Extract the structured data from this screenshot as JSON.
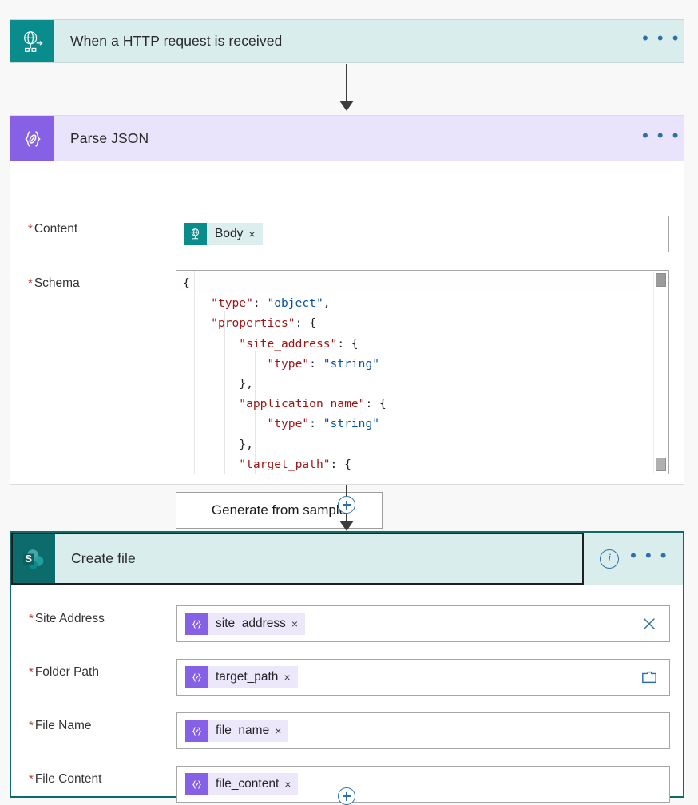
{
  "flow": {
    "trigger": {
      "title": "When a HTTP request is received",
      "icon": "globe-http-icon",
      "menu": "• • •",
      "header_bg": "#d9eded",
      "icon_bg": "#0b8c8c"
    },
    "parse_json": {
      "title": "Parse JSON",
      "icon": "braces-json-icon",
      "menu": "• • •",
      "header_bg": "#e9e4fc",
      "icon_bg": "#8661e5",
      "fields": {
        "content": {
          "label": "Content",
          "required_marker": "*",
          "token": {
            "label": "Body",
            "icon": "globe-http-icon",
            "remove": "×",
            "icon_bg": "#0b8c8c",
            "chip_bg": "#ddeeee"
          }
        },
        "schema": {
          "label": "Schema",
          "required_marker": "*",
          "code_lines": [
            [
              {
                "t": "{",
                "c": "p"
              }
            ],
            [
              {
                "t": "    ",
                "c": "p"
              },
              {
                "t": "\"type\"",
                "c": "k"
              },
              {
                "t": ": ",
                "c": "p"
              },
              {
                "t": "\"object\"",
                "c": "s"
              },
              {
                "t": ",",
                "c": "p"
              }
            ],
            [
              {
                "t": "    ",
                "c": "p"
              },
              {
                "t": "\"properties\"",
                "c": "k"
              },
              {
                "t": ": {",
                "c": "p"
              }
            ],
            [
              {
                "t": "        ",
                "c": "p"
              },
              {
                "t": "\"site_address\"",
                "c": "k"
              },
              {
                "t": ": {",
                "c": "p"
              }
            ],
            [
              {
                "t": "            ",
                "c": "p"
              },
              {
                "t": "\"type\"",
                "c": "k"
              },
              {
                "t": ": ",
                "c": "p"
              },
              {
                "t": "\"string\"",
                "c": "s"
              }
            ],
            [
              {
                "t": "        },",
                "c": "p"
              }
            ],
            [
              {
                "t": "        ",
                "c": "p"
              },
              {
                "t": "\"application_name\"",
                "c": "k"
              },
              {
                "t": ": {",
                "c": "p"
              }
            ],
            [
              {
                "t": "            ",
                "c": "p"
              },
              {
                "t": "\"type\"",
                "c": "k"
              },
              {
                "t": ": ",
                "c": "p"
              },
              {
                "t": "\"string\"",
                "c": "s"
              }
            ],
            [
              {
                "t": "        },",
                "c": "p"
              }
            ],
            [
              {
                "t": "        ",
                "c": "p"
              },
              {
                "t": "\"target_path\"",
                "c": "k"
              },
              {
                "t": ": {",
                "c": "p"
              }
            ]
          ]
        }
      },
      "generate_button": "Generate from sample"
    },
    "create_file": {
      "title": "Create file",
      "icon": "sharepoint-icon",
      "menu": "• • •",
      "info_icon": "info-icon",
      "info_glyph": "i",
      "header_bg": "#d9eded",
      "icon_bg": "#0c6b6b",
      "border_color": "#0c6b6b",
      "fields": [
        {
          "label": "Site Address",
          "required_marker": "*",
          "token": {
            "label": "site_address",
            "icon": "braces-json-icon",
            "remove": "×"
          },
          "trailing_icon": "clear-x-icon"
        },
        {
          "label": "Folder Path",
          "required_marker": "*",
          "token": {
            "label": "target_path",
            "icon": "braces-json-icon",
            "remove": "×"
          },
          "trailing_icon": "folder-picker-icon"
        },
        {
          "label": "File Name",
          "required_marker": "*",
          "token": {
            "label": "file_name",
            "icon": "braces-json-icon",
            "remove": "×"
          },
          "trailing_icon": null
        },
        {
          "label": "File Content",
          "required_marker": "*",
          "token": {
            "label": "file_content",
            "icon": "braces-json-icon",
            "remove": "×"
          },
          "trailing_icon": null
        }
      ]
    },
    "connectors": {
      "add_step_glyph": "+"
    }
  }
}
